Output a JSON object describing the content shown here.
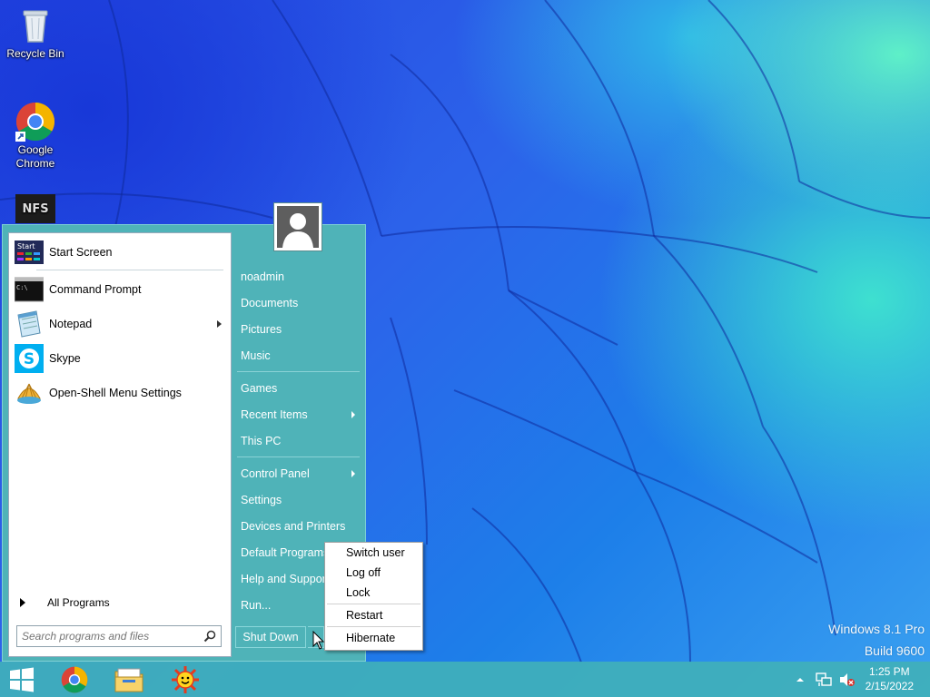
{
  "desktop": {
    "icons": [
      {
        "label": "Recycle Bin",
        "icon": "recycle-bin-icon"
      },
      {
        "label": "Google Chrome",
        "icon": "chrome-icon"
      },
      {
        "label": "",
        "icon": "nfs-game-icon"
      }
    ]
  },
  "start_menu": {
    "pinned": [
      {
        "label": "Start Screen",
        "icon": "start-screen-icon"
      },
      {
        "label": "Command Prompt",
        "icon": "command-prompt-icon"
      },
      {
        "label": "Notepad",
        "icon": "notepad-icon",
        "has_submenu": true
      },
      {
        "label": "Skype",
        "icon": "skype-icon"
      },
      {
        "label": "Open-Shell Menu Settings",
        "icon": "open-shell-icon"
      }
    ],
    "start_icon_text": "Start",
    "cmd_icon_text": "C:\\",
    "all_programs": "All Programs",
    "search_placeholder": "Search programs and files",
    "right": {
      "user": "noadmin",
      "documents": "Documents",
      "pictures": "Pictures",
      "music": "Music",
      "games": "Games",
      "recent_items": "Recent Items",
      "this_pc": "This PC",
      "control_panel": "Control Panel",
      "settings": "Settings",
      "devices_printers": "Devices and Printers",
      "default_programs": "Default Programs",
      "help_support": "Help and Support",
      "run": "Run..."
    },
    "shutdown_label": "Shut Down"
  },
  "shutdown_menu": {
    "items": [
      "Switch user",
      "Log off",
      "Lock",
      "Restart",
      "Hibernate"
    ]
  },
  "watermark": {
    "line1": "Windows 8.1 Pro",
    "line2": "Build 9600"
  },
  "taskbar": {
    "pinned": [
      "windows-start-icon",
      "chrome-icon",
      "file-explorer-icon",
      "sun-app-icon"
    ],
    "tray_icons": [
      "tray-expand-icon",
      "network-icon",
      "volume-muted-icon"
    ],
    "time": "1:25 PM",
    "date": "2/15/2022"
  },
  "colors": {
    "start_menu_bg": "#4fb3b8",
    "taskbar_bg": "#40b0ba"
  }
}
